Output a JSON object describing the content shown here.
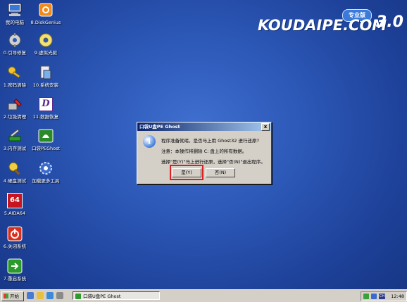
{
  "desktop_icons": [
    {
      "label": "我的电脑"
    },
    {
      "label": "0.引导修复"
    },
    {
      "label": "1.密码清除"
    },
    {
      "label": "2.垃圾清理"
    },
    {
      "label": "3.内存测试"
    },
    {
      "label": "4.硬盘测试"
    },
    {
      "label": "5.AIDA64"
    },
    {
      "label": "6.关闭系统"
    },
    {
      "label": "7.重启系统"
    },
    {
      "label": "8.DiskGenius"
    },
    {
      "label": "9.虚拟光驱"
    },
    {
      "label": "10.系统安装"
    },
    {
      "label": "11.数据恢复"
    },
    {
      "label": "口袋PEGhost"
    },
    {
      "label": "加载更多工具"
    }
  ],
  "aida_badge": "64",
  "logo": {
    "text": "KOUDAIPE.COM",
    "version": "3.0",
    "badge": "专业版"
  },
  "dialog": {
    "title": "口袋U盘PE Ghost",
    "close": "x",
    "info_glyph": "i",
    "message_line1": "程序准备就绪，是否马上用 Ghost32 进行还原?",
    "message_line2": "注意：本操作将删除 C: 盘上的所有数据。",
    "message_line3": "选择\"是(Y)\"马上进行还原，选择\"否(N)\"退出程序。",
    "yes_label": "是(Y)",
    "no_label": "否(N)"
  },
  "taskbar": {
    "start_label": "开始",
    "task_label": "口袋U盘PE Ghost",
    "clock": "12:48",
    "tray_ch": "CH"
  },
  "colors": {
    "desktop": "#2d59b8",
    "title_bar": "#0a246a",
    "highlight": "#e02020"
  }
}
